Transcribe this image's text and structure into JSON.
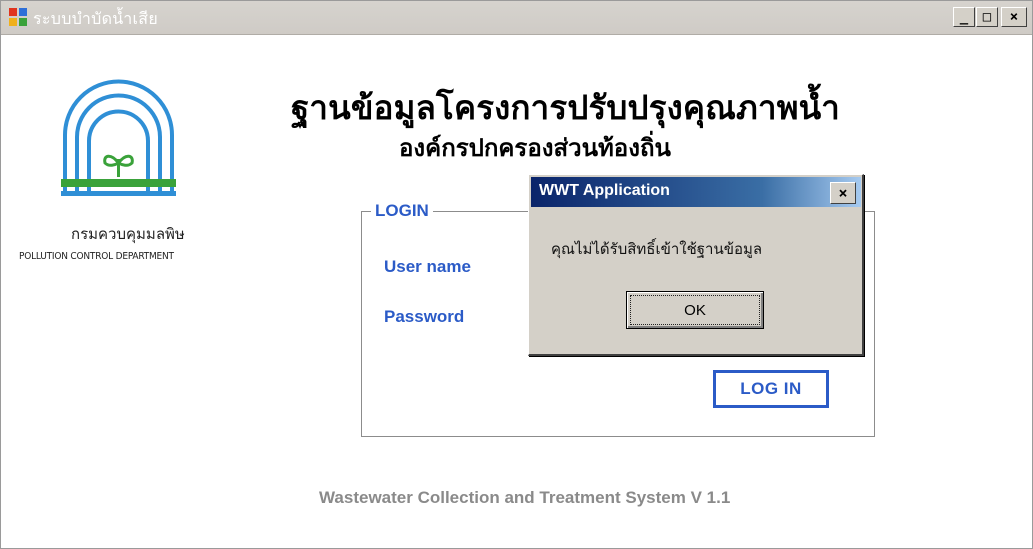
{
  "window": {
    "title": "ระบบบำบัดน้ำเสีย",
    "minimize_glyph": "_",
    "maximize_glyph": "□",
    "close_glyph": "×"
  },
  "branding": {
    "logo_icon": "pcd-logo-icon",
    "department_th": "กรมควบคุมมลพิษ",
    "department_en": "POLLUTION CONTROL DEPARTMENT"
  },
  "header": {
    "title": "ฐานข้อมูลโครงการปรับปรุงคุณภาพน้ำ",
    "subtitle": "องค์กรปกครองส่วนท้องถิ่น"
  },
  "login": {
    "group_label": "LOGIN",
    "username_label": "User name",
    "password_label": "Password",
    "login_button": "LOG IN"
  },
  "footer": {
    "text": "Wastewater Collection and Treatment System V 1.1"
  },
  "dialog": {
    "title": "WWT Application",
    "close_glyph": "×",
    "message": "คุณไม่ได้รับสิทธิ์เข้าใช้ฐานข้อมูล",
    "ok_label": "OK"
  },
  "colors": {
    "accent_blue": "#2b5bc7",
    "dialog_title_start": "#0a246a",
    "dialog_title_end": "#a6caf0",
    "logo_green": "#3aa23a",
    "logo_blue": "#2f8fd6"
  }
}
